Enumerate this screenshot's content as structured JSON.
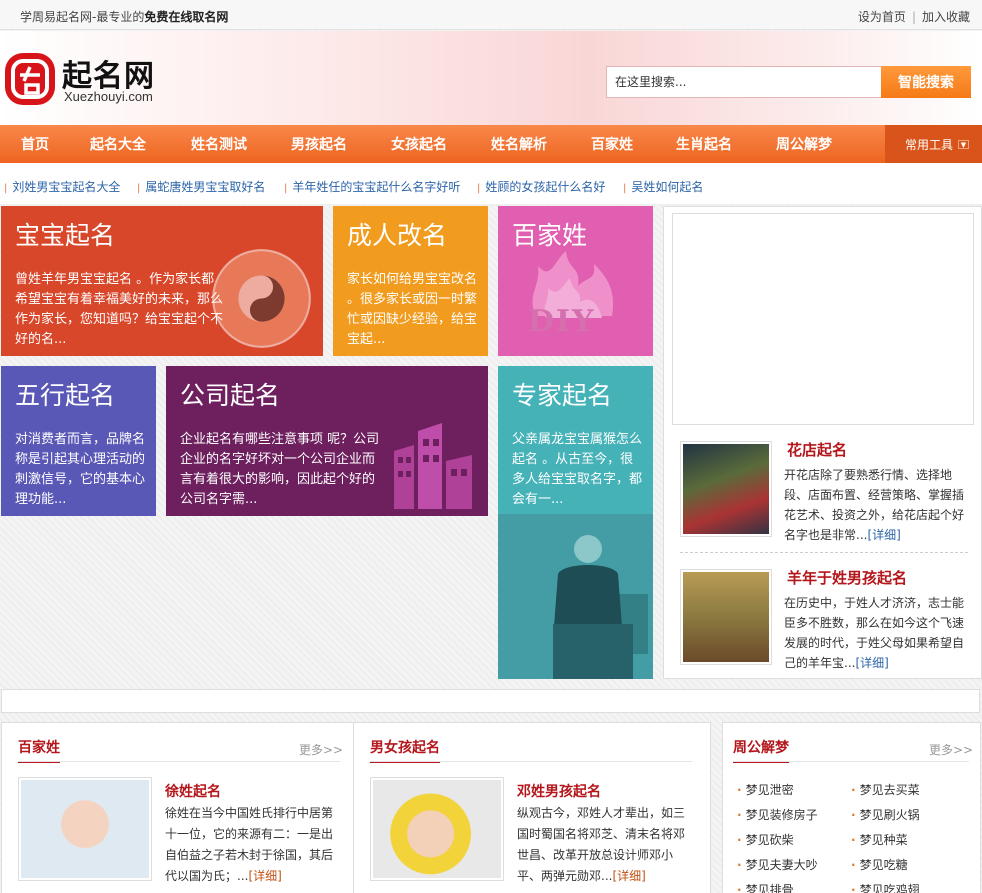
{
  "topbar": {
    "slogan_prefix": "学周易起名网-最专业的",
    "slogan_bold": "免费在线取名网",
    "set_home": "设为首页",
    "separator": "|",
    "add_favorite": "加入收藏"
  },
  "logo": {
    "name": "起名网",
    "url": "Xuezhouyi.com",
    "mark": "名"
  },
  "search": {
    "placeholder": "在这里搜索...",
    "button": "智能搜索"
  },
  "nav": {
    "items": [
      "首页",
      "起名大全",
      "姓名测试",
      "男孩起名",
      "女孩起名",
      "姓名解析",
      "百家姓",
      "生肖起名",
      "周公解梦"
    ],
    "tools": "常用工具"
  },
  "hotlinks": [
    "刘姓男宝宝起名大全",
    "属蛇唐姓男宝宝取好名",
    "羊年姓任的宝宝起什么名字好听",
    "姓顾的女孩起什么名好",
    "吴姓如何起名"
  ],
  "tiles": {
    "baby": {
      "title": "宝宝起名",
      "desc": "曾姓羊年男宝宝起名 。作为家长都希望宝宝有着幸福美好的未来，那么作为家长，您知道吗？给宝宝起个不好的名...",
      "color": "#d9472b"
    },
    "adult": {
      "title": "成人改名",
      "desc": "家长如何给男宝宝改名 。很多家长或因一时繁忙或因缺少经验，给宝宝起...",
      "color": "#f29c1f"
    },
    "surname": {
      "title": "百家姓",
      "deco": "DIY",
      "color": "#e05fb0"
    },
    "wuxing": {
      "title": "五行起名",
      "desc": "对消费者而言，品牌名称是引起其心理活动的刺激信号，它的基本心理功能...",
      "color": "#5a58b6"
    },
    "company": {
      "title": "公司起名",
      "desc": "企业起名有哪些注意事项 呢？公司企业的名字好坏对一个公司企业而言有着很大的影响，因此起个好的公司名字需...",
      "color": "#6d1f5e"
    },
    "expert": {
      "title": "专家起名",
      "desc": "父亲属龙宝宝属猴怎么起名 。从古至今，很多人给宝宝取名字，都会有一...",
      "color": "#45b2b8"
    }
  },
  "side_items": [
    {
      "title": "花店起名",
      "desc": "开花店除了要熟悉行情、选择地段、店面布置、经营策略、掌握插花艺术、投资之外，给花店起个好名字也是非常...",
      "more": "[详细]"
    },
    {
      "title": "羊年于姓男孩起名",
      "desc": "在历史中，于姓人才济济，志士能臣多不胜数，那么在如今这个飞速发展的时代，于姓父母如果希望自己的羊年宝...",
      "more": "[详细]"
    }
  ],
  "sections": {
    "surname": {
      "title": "百家姓",
      "more": "更多>>",
      "item": {
        "title": "徐姓起名",
        "desc": "徐姓在当今中国姓氏排行中居第十一位，它的来源有二：一是出自伯益之子若木封于徐国，其后代以国为氏；...",
        "more": "[详细]"
      }
    },
    "boygirl": {
      "title": "男女孩起名",
      "item": {
        "title": "邓姓男孩起名",
        "desc": "纵观古今，邓姓人才辈出，如三国时蜀国名将邓芝、清末名将邓世昌、改革开放总设计师邓小平、两弹元勋邓...",
        "more": "[详细]"
      }
    },
    "dream": {
      "title": "周公解梦",
      "more": "更多>>",
      "col1": [
        "梦见泄密",
        "梦见装修房子",
        "梦见砍柴",
        "梦见夫妻大吵",
        "梦见排骨"
      ],
      "col2": [
        "梦见去买菜",
        "梦见刷火锅",
        "梦见种菜",
        "梦见吃糖",
        "梦见吃鸡翅"
      ]
    }
  }
}
